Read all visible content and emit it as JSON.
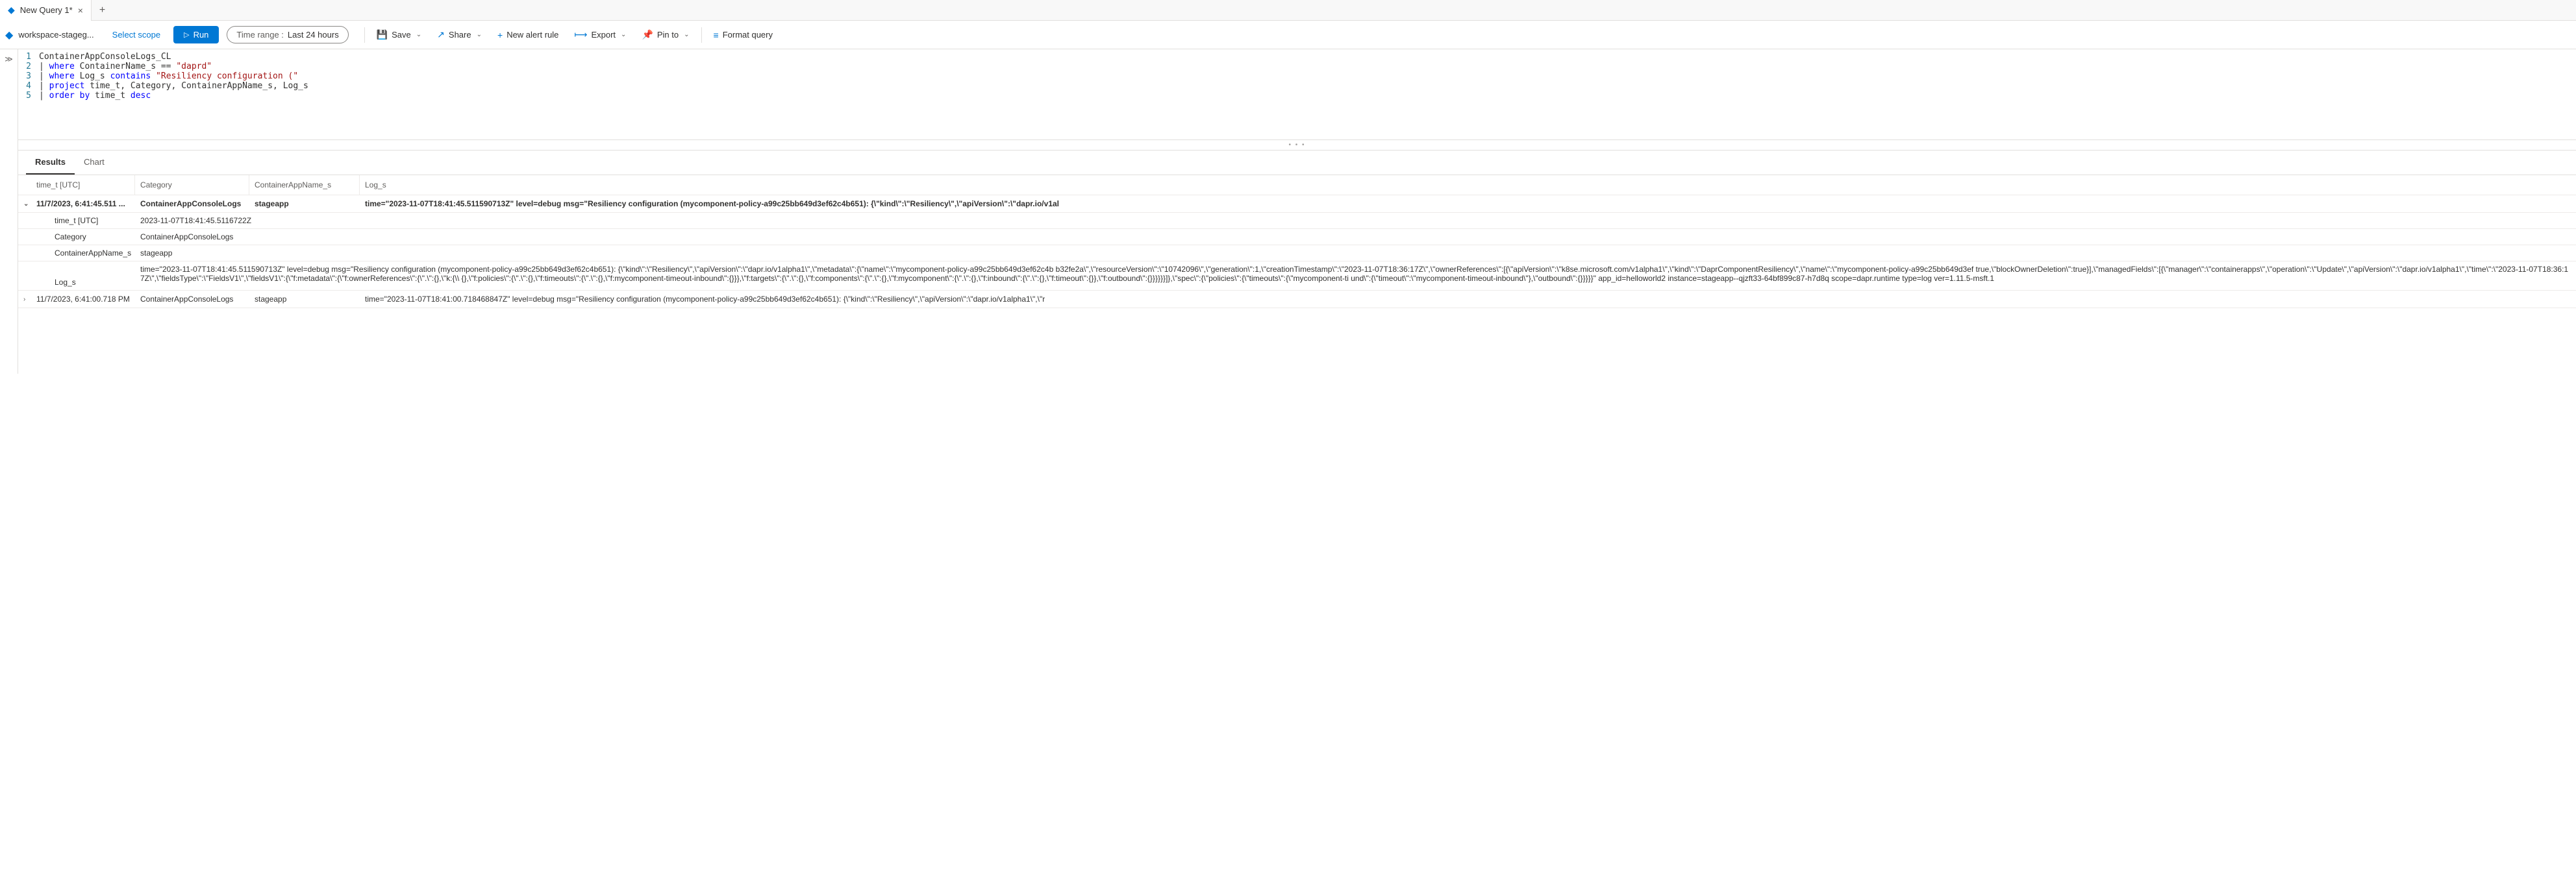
{
  "tab": {
    "title": "New Query 1*"
  },
  "toolbar": {
    "workspace": "workspace-stageg...",
    "select_scope": "Select scope",
    "run": "Run",
    "time_range_label": "Time range :",
    "time_range_value": "Last 24 hours",
    "save": "Save",
    "share": "Share",
    "new_alert": "New alert rule",
    "export": "Export",
    "pin_to": "Pin to",
    "format": "Format query"
  },
  "editor_lines": [
    {
      "num": "1",
      "html": "ContainerAppConsoleLogs_CL"
    },
    {
      "num": "2",
      "html": "| <span class='kw'>where</span> ContainerName_s == <span class='str'>\"daprd\"</span>"
    },
    {
      "num": "3",
      "html": "| <span class='kw'>where</span> Log_s <span class='kw'>contains</span> <span class='str'>\"Resiliency configuration (\"</span>"
    },
    {
      "num": "4",
      "html": "| <span class='kw'>project</span> time_t, Category, ContainerAppName_s, Log_s"
    },
    {
      "num": "5",
      "html": "| <span class='kw'>order by</span> time_t <span class='kw'>desc</span>"
    }
  ],
  "results": {
    "tab_results": "Results",
    "tab_chart": "Chart",
    "headers": {
      "time": "time_t [UTC]",
      "category": "Category",
      "app": "ContainerAppName_s",
      "log": "Log_s"
    },
    "rows": [
      {
        "expanded": true,
        "time": "11/7/2023, 6:41:45.511 ...",
        "category": "ContainerAppConsoleLogs",
        "app": "stageapp",
        "log": "time=\"2023-11-07T18:41:45.511590713Z\" level=debug msg=\"Resiliency configuration (mycomponent-policy-a99c25bb649d3ef62c4b651): {\\\"kind\\\":\\\"Resiliency\\\",\\\"apiVersion\\\":\\\"dapr.io/v1al",
        "details": {
          "time_t": {
            "key": "time_t [UTC]",
            "val": "2023-11-07T18:41:45.5116722Z"
          },
          "category": {
            "key": "Category",
            "val": "ContainerAppConsoleLogs"
          },
          "app": {
            "key": "ContainerAppName_s",
            "val": "stageapp"
          },
          "log": {
            "key": "Log_s",
            "val": "time=\"2023-11-07T18:41:45.511590713Z\" level=debug msg=\"Resiliency configuration (mycomponent-policy-a99c25bb649d3ef62c4b651): {\\\"kind\\\":\\\"Resiliency\\\",\\\"apiVersion\\\":\\\"dapr.io/v1alpha1\\\",\\\"metadata\\\":{\\\"name\\\":\\\"mycomponent-policy-a99c25bb649d3ef62c4b b32fe2a\\\",\\\"resourceVersion\\\":\\\"10742096\\\",\\\"generation\\\":1,\\\"creationTimestamp\\\":\\\"2023-11-07T18:36:17Z\\\",\\\"ownerReferences\\\":[{\\\"apiVersion\\\":\\\"k8se.microsoft.com/v1alpha1\\\",\\\"kind\\\":\\\"DaprComponentResiliency\\\",\\\"name\\\":\\\"mycomponent-policy-a99c25bb649d3ef true,\\\"blockOwnerDeletion\\\":true}],\\\"managedFields\\\":[{\\\"manager\\\":\\\"containerapps\\\",\\\"operation\\\":\\\"Update\\\",\\\"apiVersion\\\":\\\"dapr.io/v1alpha1\\\",\\\"time\\\":\\\"2023-11-07T18:36:17Z\\\",\\\"fieldsType\\\":\\\"FieldsV1\\\",\\\"fieldsV1\\\":{\\\"f:metadata\\\":{\\\"f:ownerReferences\\\":{\\\".\\\":{},\\\"k:{\\\\ {},\\\"f:policies\\\":{\\\".\\\":{},\\\"f:timeouts\\\":{\\\".\\\":{},\\\"f:mycomponent-timeout-inbound\\\":{}}},\\\"f:targets\\\":{\\\".\\\":{},\\\"f:components\\\":{\\\".\\\":{},\\\"f:mycomponent\\\":{\\\".\\\":{},\\\"f:inbound\\\":{\\\".\\\":{},\\\"f:timeout\\\":{}},\\\"f:outbound\\\":{}}}}}}]},\\\"spec\\\":{\\\"policies\\\":{\\\"timeouts\\\":{\\\"mycomponent-ti und\\\":{\\\"timeout\\\":\\\"mycomponent-timeout-inbound\\\"},\\\"outbound\\\":{}}}}}\" app_id=helloworld2 instance=stageapp--qjzft33-64bf899c87-h7d8q scope=dapr.runtime type=log ver=1.11.5-msft.1"
          }
        }
      },
      {
        "expanded": false,
        "time": "11/7/2023, 6:41:00.718 PM",
        "category": "ContainerAppConsoleLogs",
        "app": "stageapp",
        "log": "time=\"2023-11-07T18:41:00.718468847Z\" level=debug msg=\"Resiliency configuration (mycomponent-policy-a99c25bb649d3ef62c4b651): {\\\"kind\\\":\\\"Resiliency\\\",\\\"apiVersion\\\":\\\"dapr.io/v1alpha1\\\",\\\"r"
      }
    ]
  }
}
